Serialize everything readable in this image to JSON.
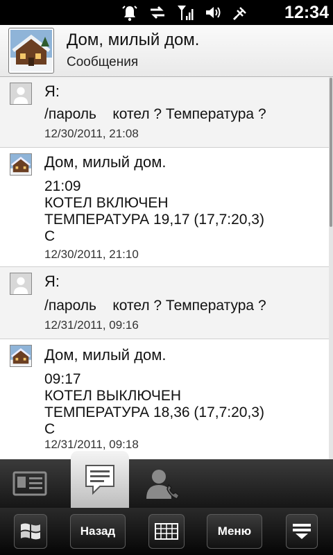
{
  "status_bar": {
    "time": "12:34",
    "icons": [
      "alarm-icon",
      "sync-icon",
      "signal-icon",
      "volume-icon",
      "power-plug-icon"
    ]
  },
  "header": {
    "title": "Дом, милый дом.",
    "subtitle": "Сообщения"
  },
  "messages": [
    {
      "sender": "Я:",
      "body": "/пароль    котел ? Температура ?",
      "time": "12/30/2011, 21:08",
      "avatar": "person-avatar"
    },
    {
      "sender": "Дом, милый дом.",
      "body": "21:09\nКОТЕЛ ВКЛЮЧЕН\nТЕМПЕРАТУРА 19,17 (17,7:20,3)\nС",
      "time": "12/30/2011, 21:10",
      "avatar": "house-avatar"
    },
    {
      "sender": "Я:",
      "body": "/пароль    котел ? Температура ?",
      "time": "12/31/2011, 09:16",
      "avatar": "person-avatar"
    },
    {
      "sender": "Дом, милый дом.",
      "body": "09:17\nКОТЕЛ ВЫКЛЮЧЕН\nТЕМПЕРАТУРА 18,36 (17,7:20,3)\nС",
      "time": "12/31/2011, 09:18",
      "avatar": "house-avatar"
    }
  ],
  "tabs": [
    {
      "icon": "contact-card-icon",
      "active": false
    },
    {
      "icon": "message-icon",
      "active": true
    },
    {
      "icon": "call-contact-icon",
      "active": false
    }
  ],
  "commands": {
    "back_label": "Назад",
    "menu_label": "Меню"
  },
  "colors": {
    "status_bar_bg": "#000000",
    "tab_bar_bg": "#2a2a2a",
    "active_tab_bg": "#e8e8e8"
  }
}
